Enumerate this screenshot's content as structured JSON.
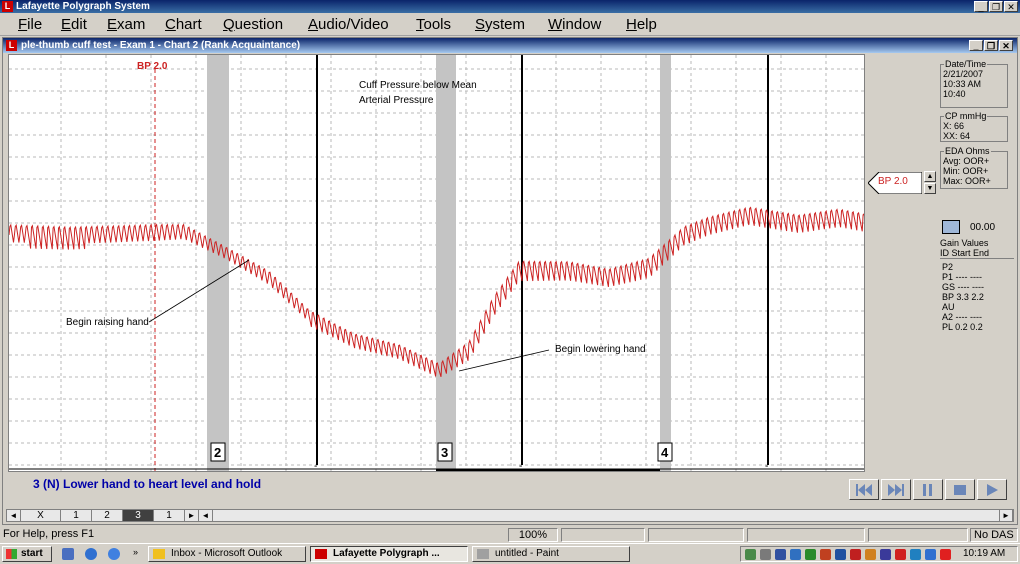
{
  "app": {
    "title": "Lafayette Polygraph System"
  },
  "menu": [
    "File",
    "Edit",
    "Exam",
    "Chart",
    "Question",
    "Audio/Video",
    "Tools",
    "System",
    "Window",
    "Help"
  ],
  "doc": {
    "title": "ple-thumb cuff test - Exam 1 - Chart 2 (Rank Acquaintance)"
  },
  "chart": {
    "bp_marker": "BP 2.0",
    "annotations": {
      "cuff": "Cuff Pressure below Mean\nArterial Pressure",
      "raise": "Begin raising hand",
      "lower": "Begin lowering hand"
    },
    "question_markers": [
      "2",
      "3",
      "4"
    ],
    "event_tick": "-"
  },
  "chart_data": {
    "type": "line",
    "series": [
      {
        "name": "",
        "color": "#cc2222"
      }
    ],
    "description_free": true
  },
  "side": {
    "bp_pointer": "BP  2.0",
    "gain_display": "00.00"
  },
  "info": {
    "datetime": {
      "header": "Date/Time",
      "lines": [
        "2/21/2007",
        "10:33 AM",
        "10:40"
      ]
    },
    "cp": {
      "header": "CP mmHg",
      "lines": [
        "X:   66",
        "XX:  64"
      ]
    },
    "eda": {
      "header": "EDA Ohms",
      "lines": [
        "Avg: OOR+",
        "Min: OOR+",
        "Max: OOR+"
      ]
    },
    "gain_values": "Gain Values",
    "gain_header": "ID  Start  End",
    "gain_rows": [
      "P2",
      "P1  ----  ----",
      "GS  ----  ----",
      "BP  3.3   2.2",
      "AU",
      "A2  ----  ----",
      "PL  0.2   0.2"
    ]
  },
  "question": {
    "text": "3 (N) Lower hand to heart level and hold"
  },
  "pages": [
    "X",
    "1",
    "2",
    "3",
    "1"
  ],
  "status": {
    "help": "For Help, press F1",
    "zoom": "100%",
    "das": "No DAS"
  },
  "taskbar": {
    "start": "start",
    "items": [
      "Inbox - Microsoft Outlook",
      "Lafayette Polygraph ...",
      "untitled - Paint"
    ],
    "clock": "10:19 AM"
  },
  "colors": {
    "trace": "#cc2222",
    "question_text": "#0000a8",
    "title_bar": "#0a246a"
  }
}
